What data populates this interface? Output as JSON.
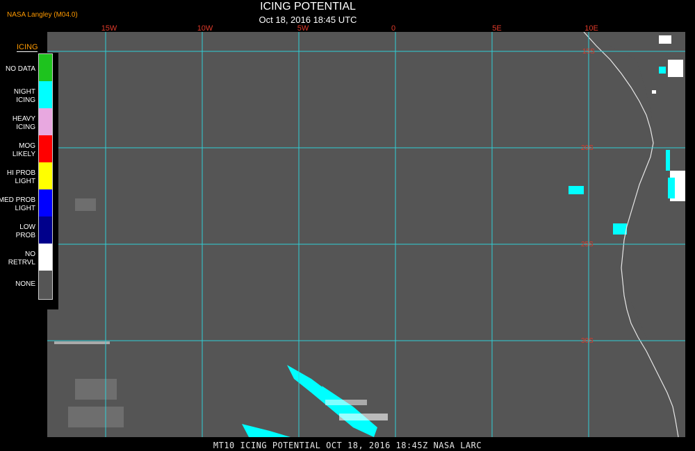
{
  "header": {
    "brand": "NASA Langley (M04.0)",
    "title": "ICING POTENTIAL",
    "subtitle": "Oct 18, 2016 18:45 UTC"
  },
  "longitude_labels": [
    "15W",
    "10W",
    "5W",
    "0",
    "5E",
    "10E"
  ],
  "latitude_labels": [
    "15S",
    "20S",
    "25S",
    "30S"
  ],
  "legend": {
    "title": "ICING",
    "items": [
      {
        "label": "NO DATA",
        "color": "#1ec31e"
      },
      {
        "label": "NIGHT\nICING",
        "color": "#00ffff"
      },
      {
        "label": "HEAVY\nICING",
        "color": "#e8a8e0"
      },
      {
        "label": "MOG\nLIKELY",
        "color": "#ff0000"
      },
      {
        "label": "HI PROB\nLIGHT",
        "color": "#ffff00"
      },
      {
        "label": "MED PROB\nLIGHT",
        "color": "#0000ff"
      },
      {
        "label": "LOW\nPROB",
        "color": "#00008b"
      },
      {
        "label": "NO\nRETRVL",
        "color": "#ffffff"
      },
      {
        "label": "NONE",
        "color": "#555555"
      }
    ]
  },
  "colors": {
    "background": "#000000",
    "map_fill": "#555555",
    "grid": "#2fd0d6",
    "coast": "#e8e8e8",
    "label_red": "#e03a2a",
    "brand_orange": "#ff9a00"
  },
  "footer": "MT10  ICING POTENTIAL   OCT 18, 2016 18:45Z   NASA LARC"
}
